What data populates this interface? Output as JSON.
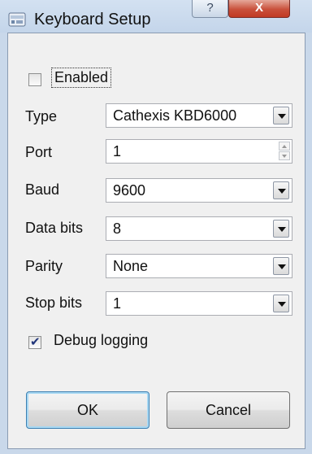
{
  "window": {
    "title": "Keyboard Setup",
    "help_label": "?",
    "close_label": "X"
  },
  "form": {
    "enabled": {
      "label": "Enabled",
      "checked": false
    },
    "fields": [
      {
        "label": "Type",
        "value": "Cathexis KBD6000",
        "control": "dropdown"
      },
      {
        "label": "Port",
        "value": "1",
        "control": "spinner"
      },
      {
        "label": "Baud",
        "value": "9600",
        "control": "dropdown"
      },
      {
        "label": "Data bits",
        "value": "8",
        "control": "dropdown"
      },
      {
        "label": "Parity",
        "value": "None",
        "control": "dropdown"
      },
      {
        "label": "Stop bits",
        "value": "1",
        "control": "dropdown"
      }
    ],
    "debug_logging": {
      "label": "Debug logging",
      "checked": true
    }
  },
  "buttons": {
    "ok_label": "OK",
    "cancel_label": "Cancel"
  },
  "colors": {
    "titlebar": "#c9d8ea",
    "close_button": "#c13a24",
    "client_background": "#f0f0f0"
  }
}
